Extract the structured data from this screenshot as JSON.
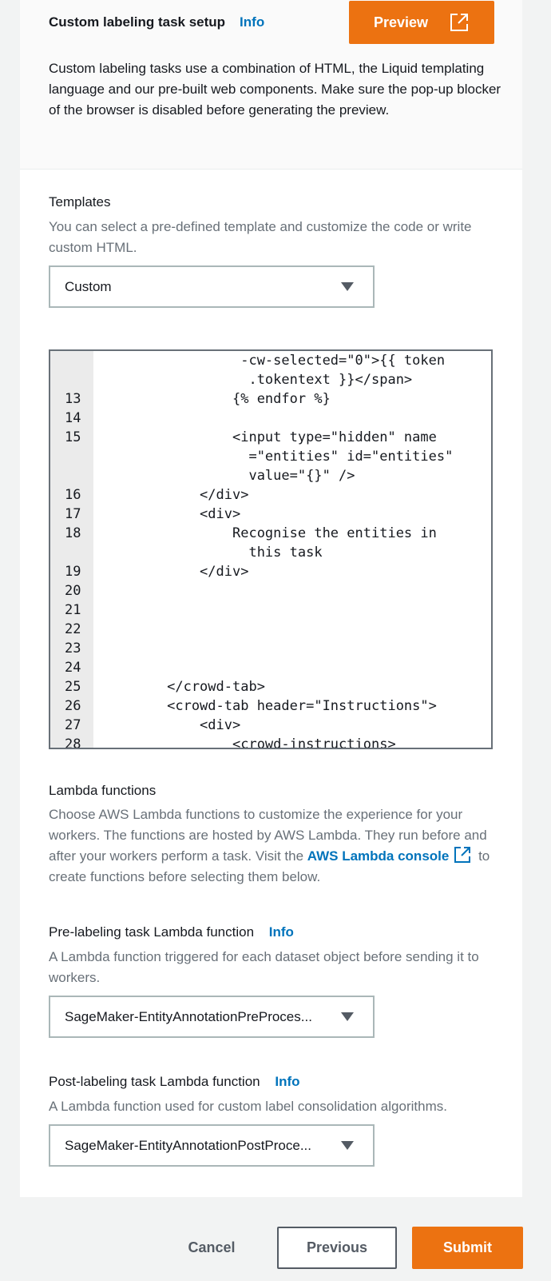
{
  "header": {
    "title": "Custom labeling task setup",
    "info": "Info",
    "preview_label": "Preview",
    "description": "Custom labeling tasks use a combination of HTML, the Liquid templating language and our pre-built web components. Make sure the pop-up blocker of the browser is disabled before generating the preview."
  },
  "templates": {
    "label": "Templates",
    "hint": "You can select a pre-defined template and customize the code or write custom HTML.",
    "selected": "Custom"
  },
  "editor": {
    "lines": [
      {
        "n": "",
        "code": "                  -cw-selected=\"0\">{{ token"
      },
      {
        "n": "",
        "code": "                   .tokentext }}</span>"
      },
      {
        "n": "13",
        "code": "                 {% endfor %}"
      },
      {
        "n": "14",
        "code": ""
      },
      {
        "n": "15",
        "code": "                 <input type=\"hidden\" name"
      },
      {
        "n": "",
        "code": "                   =\"entities\" id=\"entities\""
      },
      {
        "n": "",
        "code": "                   value=\"{}\" />"
      },
      {
        "n": "16",
        "code": "             </div>"
      },
      {
        "n": "17",
        "code": "             <div>"
      },
      {
        "n": "18",
        "code": "                 Recognise the entities in"
      },
      {
        "n": "",
        "code": "                   this task"
      },
      {
        "n": "19",
        "code": "             </div>"
      },
      {
        "n": "20",
        "code": ""
      },
      {
        "n": "21",
        "code": ""
      },
      {
        "n": "22",
        "code": ""
      },
      {
        "n": "23",
        "code": ""
      },
      {
        "n": "24",
        "code": ""
      },
      {
        "n": "25",
        "code": "         </crowd-tab>"
      },
      {
        "n": "26",
        "code": "         <crowd-tab header=\"Instructions\">"
      },
      {
        "n": "27",
        "code": "             <div>"
      },
      {
        "n": "28",
        "code": "                 <crowd-instructions>"
      }
    ]
  },
  "lambda": {
    "label": "Lambda functions",
    "hint_start": "Choose AWS Lambda functions to customize the experience for your workers. The functions are hosted by AWS Lambda. They run before and after your workers perform a task. Visit the ",
    "console_link": "AWS Lambda console",
    "hint_end": " to create functions before selecting them below."
  },
  "pre_lambda": {
    "label": "Pre-labeling task Lambda function",
    "info": "Info",
    "hint": "A Lambda function triggered for each dataset object before sending it to workers.",
    "selected": "SageMaker-EntityAnnotationPreProces..."
  },
  "post_lambda": {
    "label": "Post-labeling task Lambda function",
    "info": "Info",
    "hint": "A Lambda function used for custom label consolidation algorithms.",
    "selected": "SageMaker-EntityAnnotationPostProce..."
  },
  "footer": {
    "cancel": "Cancel",
    "previous": "Previous",
    "submit": "Submit"
  },
  "colors": {
    "accent": "#ec7211",
    "link": "#0073bb",
    "background": "#f2f3f3"
  }
}
